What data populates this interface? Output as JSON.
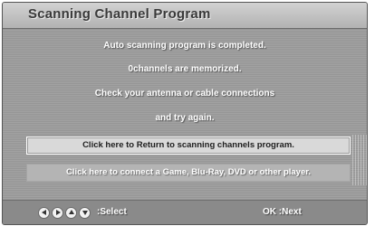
{
  "dialog": {
    "title": "Scanning Channel Program",
    "messages": [
      "Auto scanning program is completed.",
      "0channels are memorized.",
      "Check your antenna or cable connections",
      "and try again."
    ]
  },
  "options": [
    {
      "label": "Click here to Return to scanning channels program.",
      "selected": true
    },
    {
      "label": "Click here to connect a Game, Blu-Ray, DVD or other player.",
      "selected": false
    }
  ],
  "footer": {
    "nav_icons": [
      "arrow-left-icon",
      "arrow-right-icon",
      "arrow-up-icon",
      "arrow-down-icon"
    ],
    "select_label": ":Select",
    "next_label": "OK :Next"
  },
  "colors": {
    "panel": "#9c9c9c",
    "title_bar": "#c4c4c4",
    "selected_option": "#d9d9d9",
    "footer": "#8a8a8a"
  }
}
